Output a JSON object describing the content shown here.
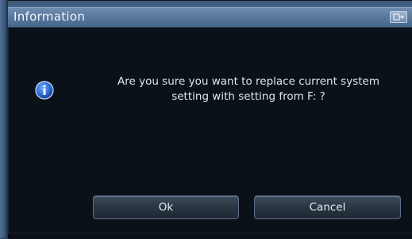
{
  "window": {
    "title": "Information"
  },
  "dialog": {
    "icon": "info-icon",
    "message_line1": "Are you sure you want to replace current system",
    "message_line2": "setting with setting from F: ?"
  },
  "buttons": {
    "ok_label": "Ok",
    "cancel_label": "Cancel"
  },
  "colors": {
    "titlebar": "#5a799d",
    "background": "#0b1118",
    "text": "#dfe6ee",
    "icon_blue": "#2f6fd6"
  }
}
